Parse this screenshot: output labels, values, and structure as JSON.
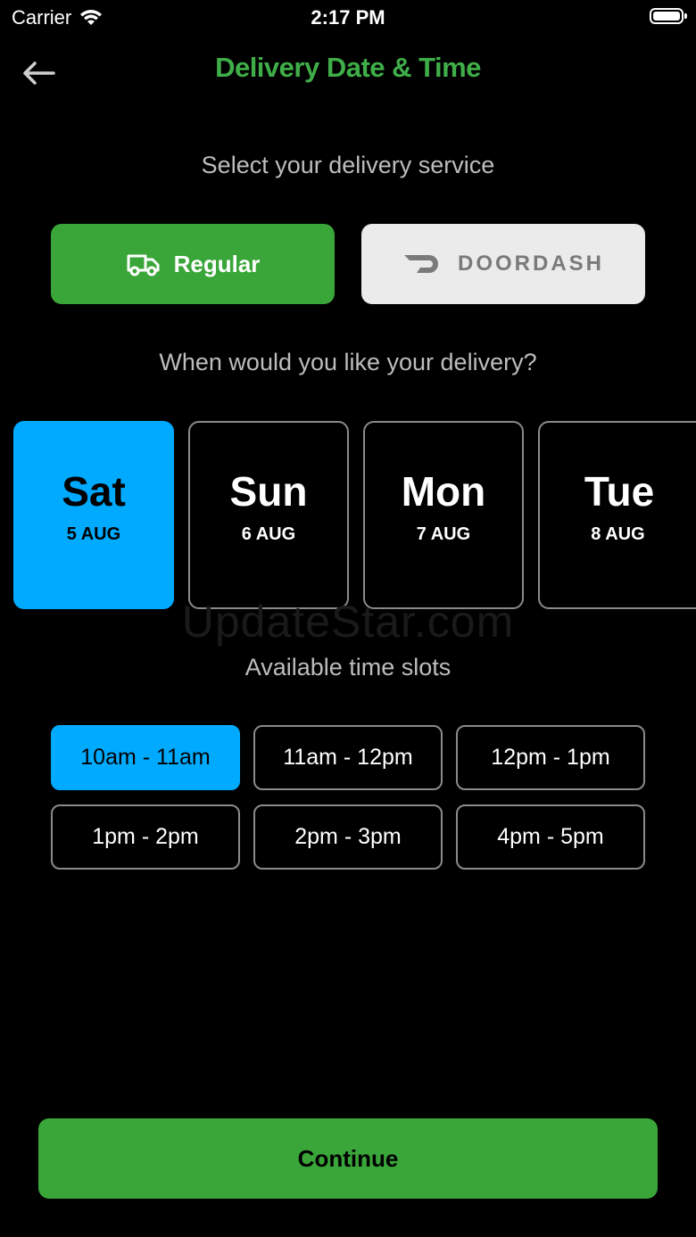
{
  "status_bar": {
    "carrier": "Carrier",
    "time": "2:17 PM"
  },
  "header": {
    "title": "Delivery Date & Time",
    "back_icon": "arrow-left-icon"
  },
  "service": {
    "prompt": "Select your delivery service",
    "options": [
      {
        "label": "Regular",
        "icon": "truck-icon",
        "selected": true
      },
      {
        "label": "DOORDASH",
        "icon": "doordash-logo-icon",
        "selected": false
      }
    ]
  },
  "date": {
    "prompt": "When would you like your delivery?",
    "days": [
      {
        "day": "Sat",
        "date": "5 AUG",
        "selected": true
      },
      {
        "day": "Sun",
        "date": "6 AUG",
        "selected": false
      },
      {
        "day": "Mon",
        "date": "7 AUG",
        "selected": false
      },
      {
        "day": "Tue",
        "date": "8 AUG",
        "selected": false
      }
    ]
  },
  "watermark": "UpdateStar.com",
  "slots": {
    "prompt": "Available time slots",
    "items": [
      {
        "label": "10am - 11am",
        "selected": true
      },
      {
        "label": "11am - 12pm",
        "selected": false
      },
      {
        "label": "12pm - 1pm",
        "selected": false
      },
      {
        "label": "1pm - 2pm",
        "selected": false
      },
      {
        "label": "2pm - 3pm",
        "selected": false
      },
      {
        "label": "4pm - 5pm",
        "selected": false
      }
    ]
  },
  "footer": {
    "continue_label": "Continue"
  },
  "colors": {
    "background": "#000000",
    "brand_green": "#3aa63a",
    "title_green": "#3fae49",
    "selected_blue": "#00aaff",
    "doordash_bg": "#ebebeb",
    "doordash_text": "#7a7a7a",
    "muted_text": "#bdbdbd"
  }
}
